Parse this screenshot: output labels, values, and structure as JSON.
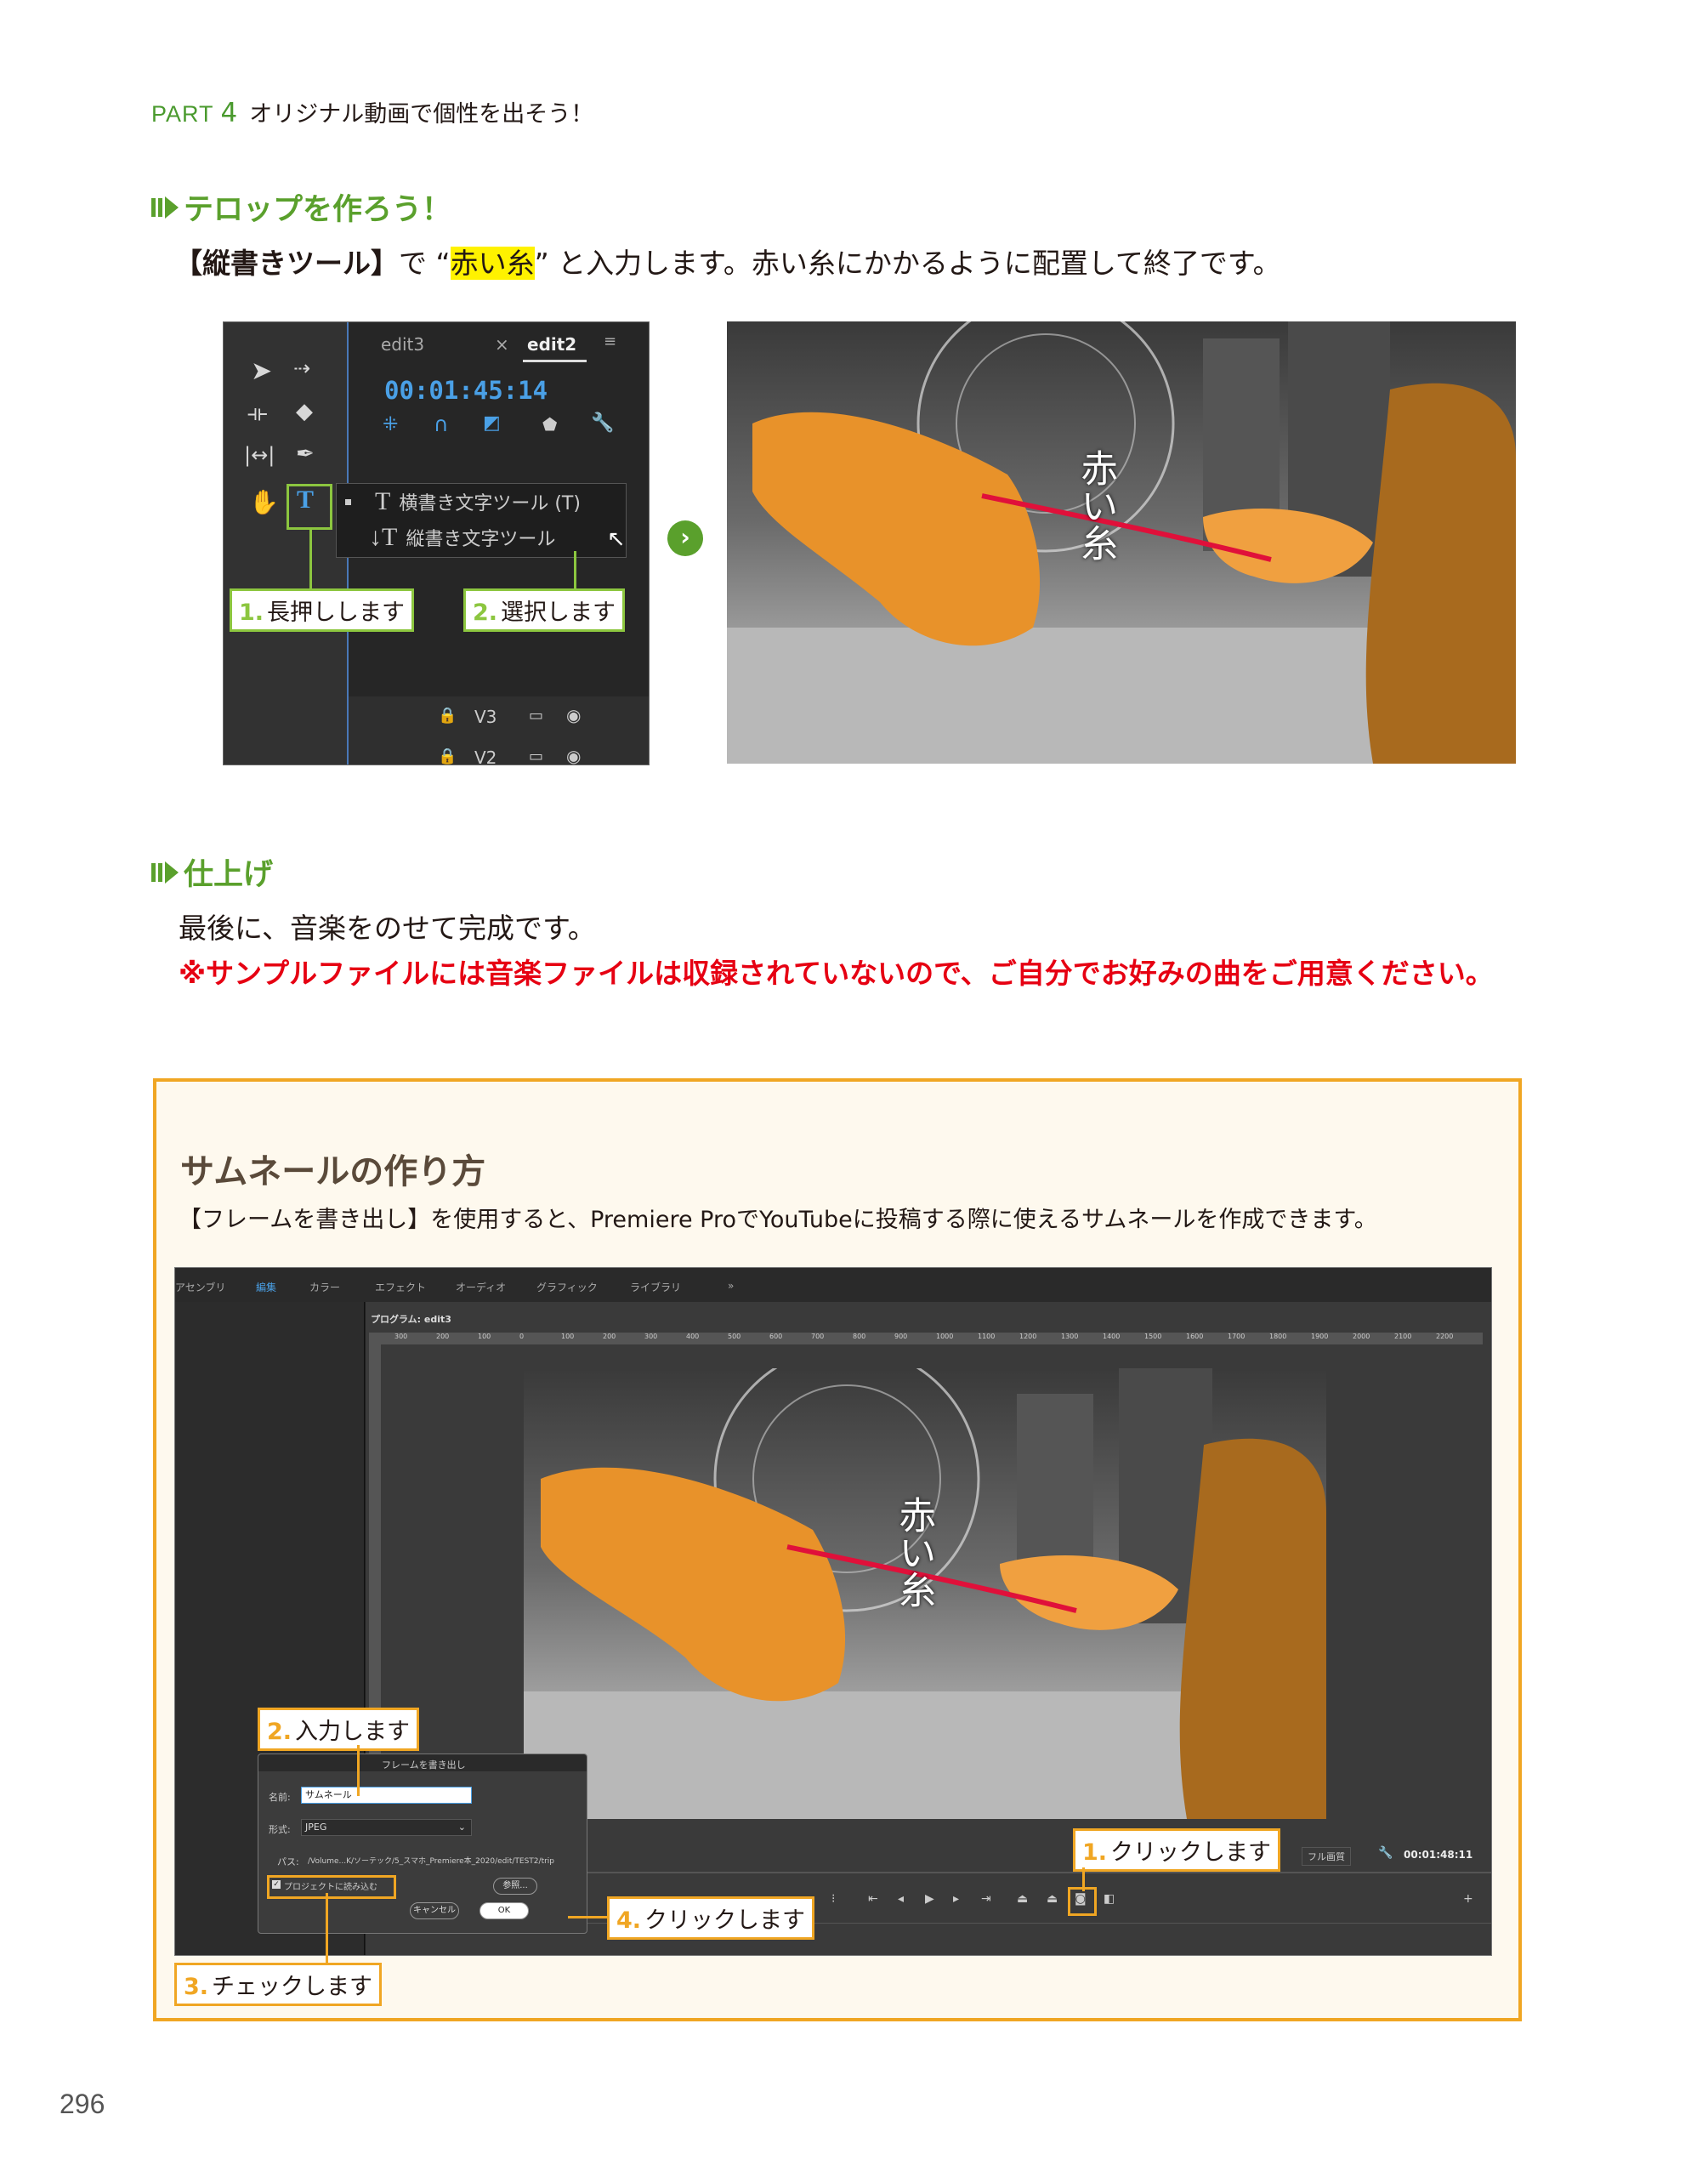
{
  "header": {
    "part": "PART",
    "part_num": "4",
    "title": "オリジナル動画で個性を出そう！"
  },
  "section1": {
    "heading": "テロップを作ろう！",
    "text_tool": "【縦書きツール】",
    "text_a": "で “",
    "text_hl": "赤い糸",
    "text_b": "” と入力します。赤い糸にかかるように配置して終了です。"
  },
  "tools_panel": {
    "tab1": "edit3",
    "tab_close": "×",
    "tab2": "edit2",
    "timecode": "00:01:45:14",
    "menu_item1_glyph": "T",
    "menu_item1": "横書き文字ツール (T)",
    "menu_item2_glyph": "↓T",
    "menu_item2": "縦書き文字ツール",
    "track_v3": "V3",
    "track_v2": "V2",
    "callout1_num": "1.",
    "callout1": "長押しします",
    "callout2_num": "2.",
    "callout2": "選択します",
    "type_tool_glyph": "T"
  },
  "arrow_glyph": "›",
  "photo": {
    "vertical_text": "赤い糸"
  },
  "section2": {
    "heading": "仕上げ",
    "text": "最後に、音楽をのせて完成です。",
    "note": "※サンプルファイルには音楽ファイルは収録されていないので、ご自分でお好みの曲をご用意ください。"
  },
  "thumbnail_box": {
    "title": "サムネールの作り方",
    "desc": "【フレームを書き出し】を使用すると、Premiere ProでYouTubeに投稿する際に使えるサムネールを作成できます。",
    "workspaces": [
      "アセンブリ",
      "編集",
      "カラー",
      "エフェクト",
      "オーディオ",
      "グラフィック",
      "ライブラリ",
      "»"
    ],
    "program_label": "プログラム: edit3",
    "ruler_ticks": [
      "300",
      "200",
      "100",
      "0",
      "100",
      "200",
      "300",
      "400",
      "500",
      "600",
      "700",
      "800",
      "900",
      "1000",
      "1100",
      "1200",
      "1300",
      "1400",
      "1500",
      "1600",
      "1700",
      "1800",
      "1900",
      "2000",
      "2100",
      "2200"
    ],
    "quality": "フル画質",
    "timecode": "00:01:48:11",
    "dialog": {
      "title": "フレームを書き出し",
      "name_label": "名前:",
      "name_value": "サムネール",
      "format_label": "形式:",
      "format_value": "JPEG",
      "path_label": "パス:",
      "path_value": "/Volume...K/ソーテック/5_スマホ_Premiere本_2020/edit/TEST2/trip",
      "import_label": "プロジェクトに読み込む",
      "browse": "参照...",
      "cancel": "キャンセル",
      "ok": "OK"
    },
    "callouts": [
      {
        "num": "1.",
        "text": "クリックします"
      },
      {
        "num": "2.",
        "text": "入力します"
      },
      {
        "num": "3.",
        "text": "チェックします"
      },
      {
        "num": "4.",
        "text": "クリックします"
      }
    ]
  },
  "page_number": "296"
}
